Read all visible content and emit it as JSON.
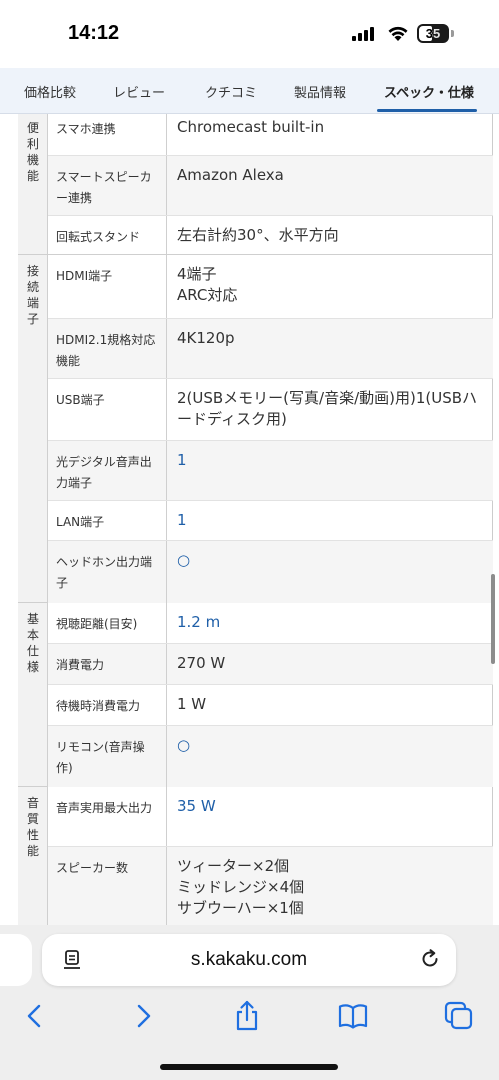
{
  "status_bar": {
    "time": "14:12",
    "battery": "35"
  },
  "tabs": [
    {
      "label": "価格比較"
    },
    {
      "label": "レビュー"
    },
    {
      "label": "クチコミ"
    },
    {
      "label": "製品情報"
    },
    {
      "label": "スペック・仕様"
    }
  ],
  "spec": {
    "sections": [
      {
        "category": "便利機能",
        "rows": [
          {
            "label": "スマホ連携",
            "value": "Chromecast built-in"
          },
          {
            "label": "スマートスピーカー連携",
            "value": "Amazon Alexa"
          },
          {
            "label": "回転式スタンド",
            "value": "左右計約30°、水平方向"
          }
        ]
      },
      {
        "category": "接続端子",
        "rows": [
          {
            "label": "HDMI端子",
            "value_lines": [
              "4端子",
              "ARC対応"
            ]
          },
          {
            "label": "HDMI2.1規格対応機能",
            "value": "4K120p"
          },
          {
            "label": "USB端子",
            "value": "2(USBメモリー(写真/音楽/動画)用)1(USBハードディスク用)"
          },
          {
            "label": "光デジタル音声出力端子",
            "value": "1"
          },
          {
            "label": "LAN端子",
            "value": "1"
          },
          {
            "label": "ヘッドホン出力端子",
            "value": "○"
          }
        ]
      },
      {
        "category": "基本仕様",
        "rows": [
          {
            "label": "視聴距離(目安)",
            "value": "1.2 m"
          },
          {
            "label": "消費電力",
            "value": "270 W"
          },
          {
            "label": "待機時消費電力",
            "value": "1 W"
          },
          {
            "label": "リモコン(音声操作)",
            "value": "○"
          }
        ]
      },
      {
        "category": "音質性能",
        "rows": [
          {
            "label": "音声実用最大出力",
            "value": "35 W"
          },
          {
            "label": "スピーカー数",
            "value_lines": [
              "ツィーター×2個",
              "ミッドレンジ×4個",
              "サブウーハー×1個"
            ]
          }
        ]
      }
    ]
  },
  "browser": {
    "url": "s.kakaku.com"
  },
  "icons": {
    "reader": "reader-mode-icon",
    "reload": "reload-icon",
    "back": "back-chevron-icon",
    "forward": "forward-chevron-icon",
    "share": "share-icon",
    "bookmarks": "bookmarks-book-icon",
    "tabs": "tabs-icon"
  },
  "colors": {
    "accent": "#1f5fa8",
    "link": "#1f5fa8",
    "tab_bar_bg": "#eef3fa"
  }
}
